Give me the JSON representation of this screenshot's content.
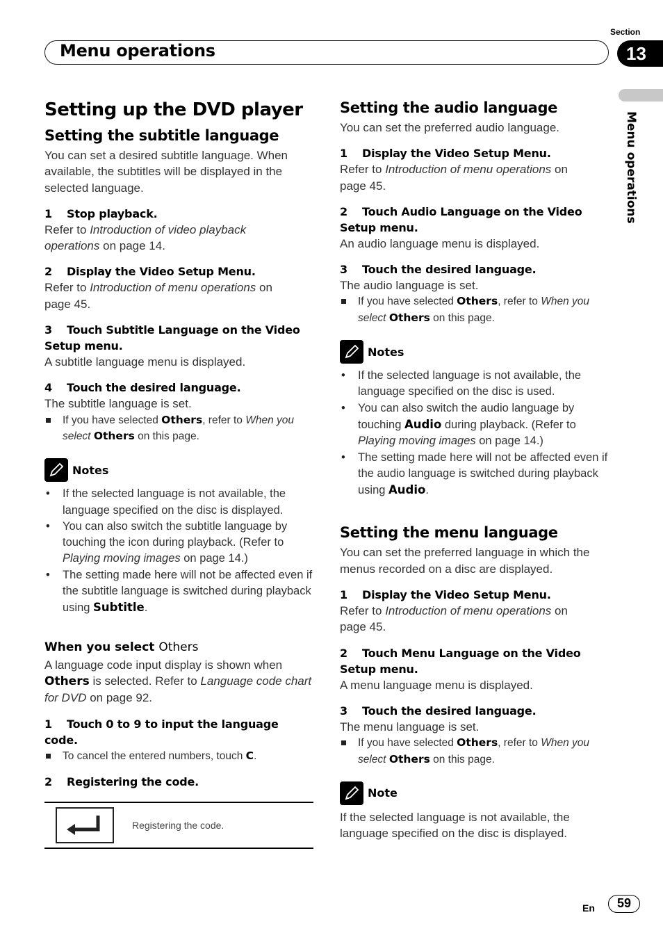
{
  "header": {
    "title": "Menu operations",
    "section_label": "Section",
    "section_number": "13",
    "side_label": "Menu operations"
  },
  "left": {
    "page_title": "Setting up the DVD player",
    "subtitle_heading": "Setting the subtitle language",
    "subtitle_intro": "You can set a desired subtitle language. When available, the subtitles will be displayed in the selected language.",
    "steps": [
      {
        "num": "1",
        "title": "Stop playback.",
        "body_pre": "Refer to ",
        "body_italic": "Introduction of video playback operations",
        "body_post": " on page 14."
      },
      {
        "num": "2",
        "title": "Display the Video Setup Menu.",
        "body_pre": "Refer to ",
        "body_italic": "Introduction of menu operations",
        "body_post": " on page 45."
      },
      {
        "num": "3",
        "title": "Touch Subtitle Language on the Video Setup menu.",
        "body": "A subtitle language menu is displayed."
      },
      {
        "num": "4",
        "title": "Touch the desired language.",
        "body": "The subtitle language is set."
      }
    ],
    "others_note": {
      "pre": "If you have selected ",
      "bold1": "Others",
      "mid": ", refer to ",
      "italic1": "When you select",
      "space": " ",
      "bold2": "Others",
      "post": " on this page."
    },
    "notes_title": "Notes",
    "notes": [
      {
        "text": "If the selected language is not available, the language specified on the disc is displayed."
      },
      {
        "pre": "You can also switch the subtitle language by touching the icon during playback. (Refer to ",
        "italic": "Playing moving images",
        "post": " on page 14.)"
      },
      {
        "pre": "The setting made here will not be affected even if the subtitle language is switched during playback using ",
        "bold": "Subtitle",
        "post": "."
      }
    ],
    "others_heading_bold": "When you select ",
    "others_heading_light": "Others",
    "others_intro": {
      "pre": "A language code input display is shown when ",
      "bold": "Others",
      "mid": " is selected. Refer to ",
      "italic": "Language code chart for DVD",
      "post": " on page 92."
    },
    "others_steps": [
      {
        "num": "1",
        "title": "Touch 0 to 9 to input the language code."
      },
      {
        "num": "2",
        "title": "Registering the code."
      }
    ],
    "cancel_note": {
      "pre": "To cancel the entered numbers, touch ",
      "bold": "C",
      "post": "."
    },
    "register_table": {
      "icon": "enter-key-icon",
      "text": "Registering the code."
    }
  },
  "right": {
    "audio_heading": "Setting the audio language",
    "audio_intro": "You can set the preferred audio language.",
    "audio_steps": [
      {
        "num": "1",
        "title": "Display the Video Setup Menu.",
        "body_pre": "Refer to ",
        "body_italic": "Introduction of menu operations",
        "body_post": " on page 45."
      },
      {
        "num": "2",
        "title": "Touch Audio Language on the Video Setup menu.",
        "body": "An audio language menu is displayed."
      },
      {
        "num": "3",
        "title": "Touch the desired language.",
        "body": "The audio language is set."
      }
    ],
    "audio_others_note": {
      "pre": "If you have selected ",
      "bold1": "Others",
      "mid": ", refer to ",
      "italic1": "When you select",
      "space": " ",
      "bold2": "Others",
      "post": " on this page."
    },
    "audio_notes_title": "Notes",
    "audio_notes": [
      {
        "text": "If the selected language is not available, the language specified on the disc is used."
      },
      {
        "pre": "You can also switch the audio language by touching ",
        "bold": "Audio",
        "mid": " during playback. (Refer to ",
        "italic": "Playing moving images",
        "post": " on page 14.)"
      },
      {
        "pre": "The setting made here will not be affected even if the audio language is switched during playback using ",
        "bold": "Audio",
        "post": "."
      }
    ],
    "menu_heading": "Setting the menu language",
    "menu_intro": "You can set the preferred language in which the menus recorded on a disc are displayed.",
    "menu_steps": [
      {
        "num": "1",
        "title": "Display the Video Setup Menu.",
        "body_pre": "Refer to ",
        "body_italic": "Introduction of menu operations",
        "body_post": " on page 45."
      },
      {
        "num": "2",
        "title": "Touch Menu Language on the Video Setup menu.",
        "body": "A menu language menu is displayed."
      },
      {
        "num": "3",
        "title": "Touch the desired language.",
        "body": "The menu language is set."
      }
    ],
    "menu_others_note": {
      "pre": "If you have selected ",
      "bold1": "Others",
      "mid": ", refer to ",
      "italic1": "When you select",
      "space": " ",
      "bold2": "Others",
      "post": " on this page."
    },
    "menu_note_title": "Note",
    "menu_note": "If the selected language is not available, the language specified on the disc is displayed."
  },
  "footer": {
    "lang": "En",
    "page_number": "59"
  }
}
